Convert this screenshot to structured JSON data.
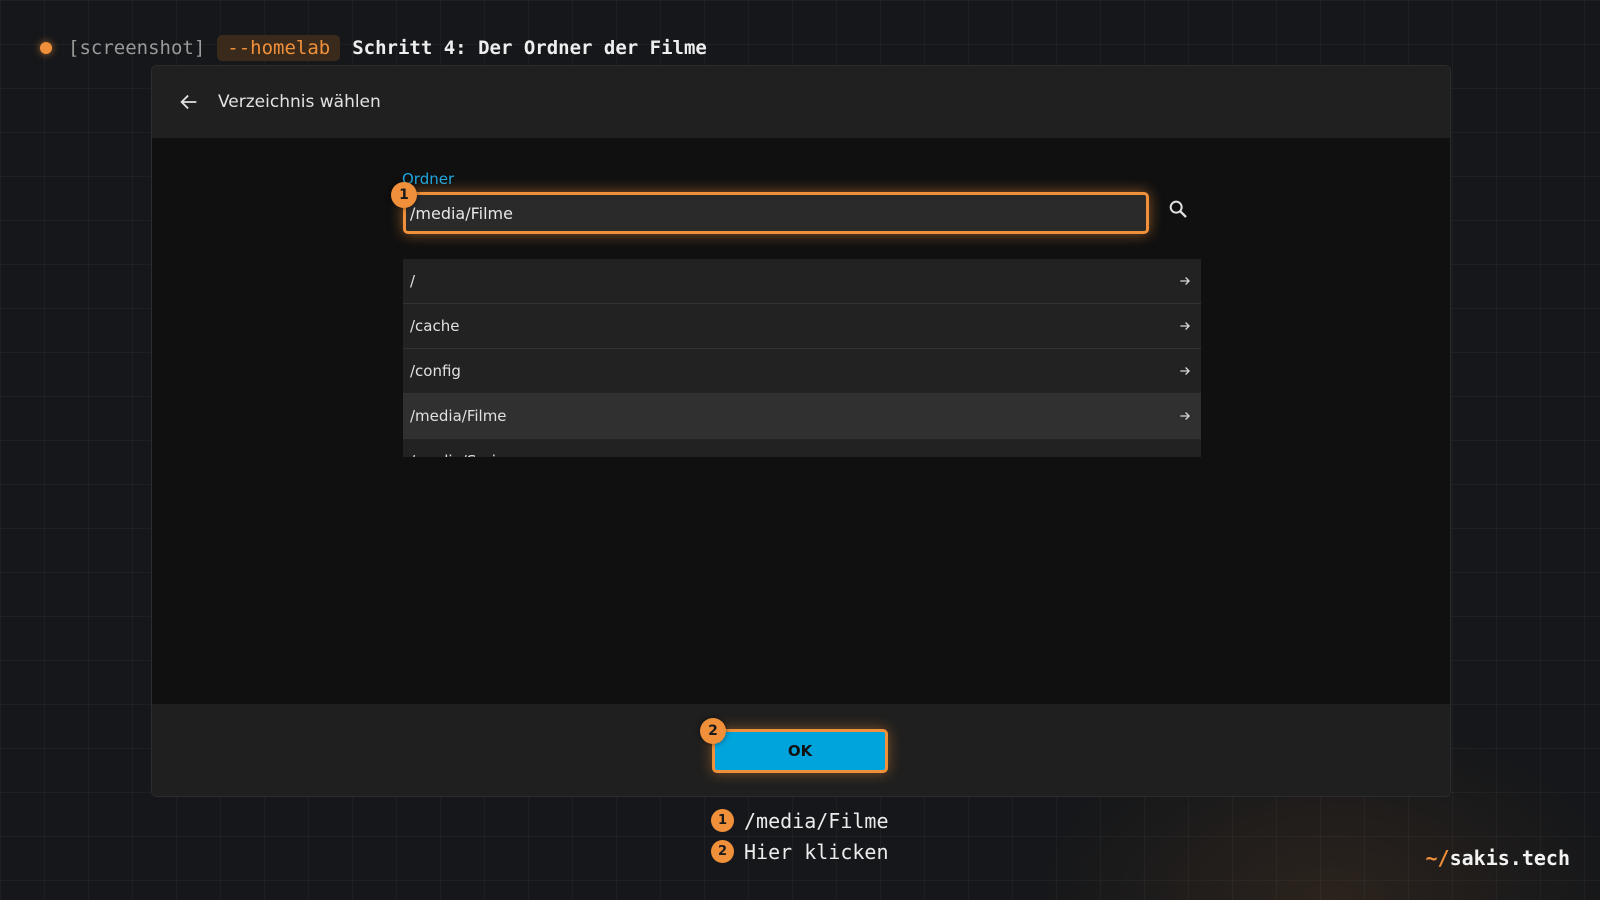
{
  "header": {
    "tag": "[screenshot]",
    "pill": "--homelab",
    "title": "Schritt 4: Der Ordner der Filme"
  },
  "dialog": {
    "title": "Verzeichnis wählen",
    "field_label": "Ordner",
    "input_value": "/media/Filme",
    "directories": [
      "/",
      "/cache",
      "/config",
      "/media/Filme",
      "/media/Serien"
    ],
    "selected_directory": "/media/Filme",
    "ok_label": "OK"
  },
  "annotations": {
    "badge1": "1",
    "badge2": "2"
  },
  "legend": [
    {
      "num": "1",
      "text": "/media/Filme"
    },
    {
      "num": "2",
      "text": "Hier klicken"
    }
  ],
  "brand": {
    "prefix": "~/",
    "name": "sakis.tech"
  },
  "colors": {
    "accent": "#f0903a",
    "primary_button": "#00a4dc",
    "label_blue": "#1ea7e1"
  },
  "icons": {
    "back": "arrow-left-icon",
    "search": "search-icon",
    "row": "arrow-right-icon"
  }
}
